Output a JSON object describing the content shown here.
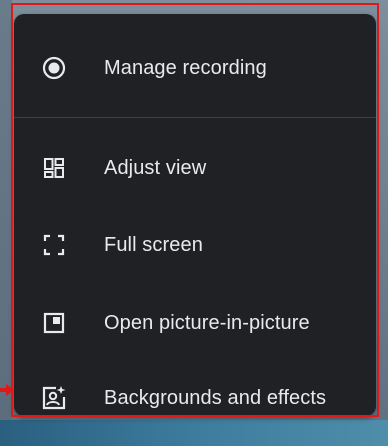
{
  "menu": {
    "items": [
      {
        "label": "Manage recording",
        "icon": "record-icon"
      },
      {
        "label": "Adjust view",
        "icon": "grid-layout-icon"
      },
      {
        "label": "Full screen",
        "icon": "fullscreen-icon"
      },
      {
        "label": "Open picture-in-picture",
        "icon": "picture-in-picture-icon"
      },
      {
        "label": "Backgrounds and effects",
        "icon": "backgrounds-effects-icon"
      }
    ]
  },
  "colors": {
    "menu_background": "#202124",
    "text": "#e8eaed",
    "icon": "#e8eaed",
    "divider": "#3c4043",
    "highlight": "#e01818"
  }
}
